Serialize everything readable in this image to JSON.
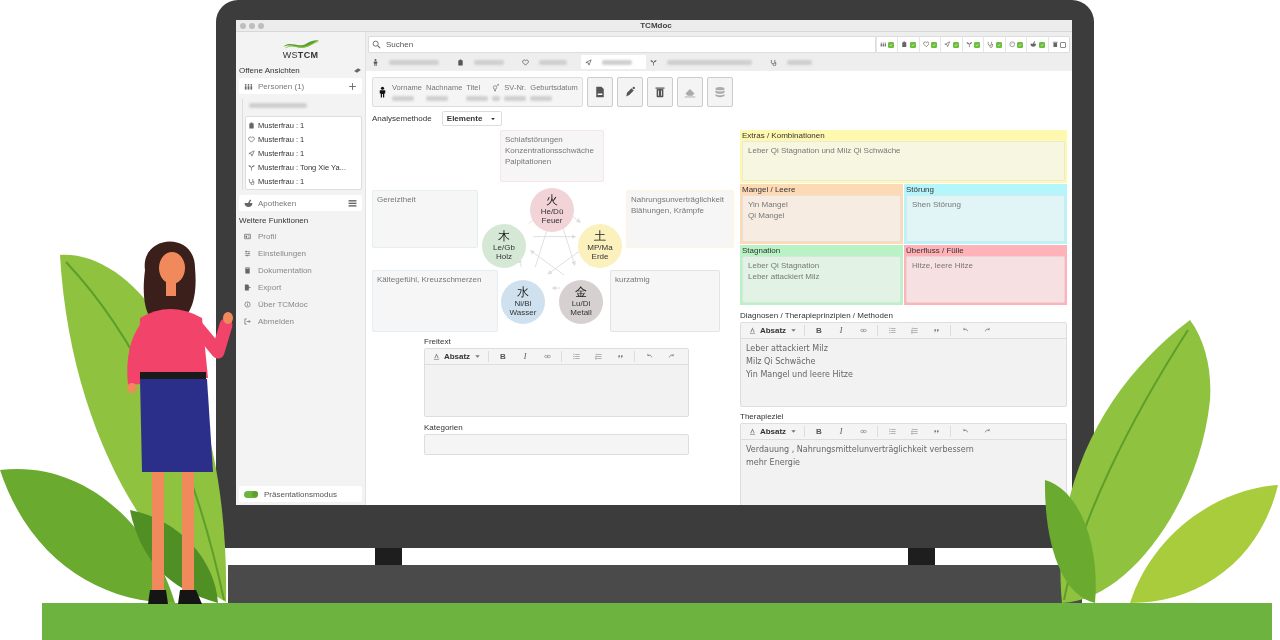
{
  "window": {
    "title": "TCMdoc"
  },
  "logo": {
    "text": "WS**TCM**"
  },
  "sidebar": {
    "open_views_label": "Offene Ansichten",
    "persons": {
      "label": "Personen (1)"
    },
    "views": [
      {
        "label": "Musterfrau : 1"
      },
      {
        "label": "Musterfrau : 1"
      },
      {
        "label": "Musterfrau : 1"
      },
      {
        "label": "Musterfrau : Tong Xie Ya..."
      },
      {
        "label": "Musterfrau : 1"
      }
    ],
    "pharmacies": {
      "label": "Apotheken"
    },
    "more_label": "Weitere Funktionen",
    "functions": [
      {
        "label": "Profil"
      },
      {
        "label": "Einstellungen"
      },
      {
        "label": "Dokumentation"
      },
      {
        "label": "Export"
      },
      {
        "label": "Über TCMdoc"
      },
      {
        "label": "Abmelden"
      }
    ],
    "presentation_mode": {
      "label": "Präsentationsmodus",
      "on": true
    }
  },
  "search": {
    "placeholder": "Suchen"
  },
  "filters": [
    {
      "checked": true
    },
    {
      "checked": true
    },
    {
      "checked": true
    },
    {
      "checked": true
    },
    {
      "checked": true
    },
    {
      "checked": true
    },
    {
      "checked": true
    },
    {
      "checked": true
    },
    {
      "checked": false
    }
  ],
  "tabs": [
    {
      "selected": false
    },
    {
      "selected": false
    },
    {
      "selected": false
    },
    {
      "selected": true
    },
    {
      "selected": false
    },
    {
      "selected": false
    }
  ],
  "patient": {
    "columns": [
      {
        "kind": "text",
        "label": "Vorname"
      },
      {
        "kind": "text",
        "label": "Nachname"
      },
      {
        "kind": "text",
        "label": "Titel"
      },
      {
        "kind": "gender"
      },
      {
        "kind": "text",
        "label": "SV-Nr."
      },
      {
        "kind": "text",
        "label": "Geburtsdatum"
      }
    ]
  },
  "analysis": {
    "label": "Analysemethode",
    "method": "Elemente"
  },
  "elements": [
    {
      "char": "火",
      "organ": "He/Dü",
      "name": "Feuer",
      "color": "#f1d3d8",
      "symptoms": [
        "Schlafstörungen",
        "Konzentrationsschwäche",
        "Palpitationen"
      ]
    },
    {
      "char": "木",
      "organ": "Le/Gb",
      "name": "Holz",
      "color": "#d5e8d5",
      "symptoms": [
        "Gereiztheit"
      ]
    },
    {
      "char": "土",
      "organ": "MP/Ma",
      "name": "Erde",
      "color": "#fbf1bd",
      "symptoms": [
        "Nahrungsunverträglichkeit",
        "Blähungen, Krämpfe"
      ]
    },
    {
      "char": "水",
      "organ": "Ni/Bl",
      "name": "Wasser",
      "color": "#cfe1ef",
      "symptoms": [
        "Kältegefühl, Kreuzschmerzen"
      ]
    },
    {
      "char": "金",
      "organ": "Lu/Di",
      "name": "Metall",
      "color": "#d6d0d0",
      "symptoms": [
        "kurzatmig"
      ]
    }
  ],
  "freitext": {
    "label": "Freitext",
    "toolbar": {
      "format": "Absatz",
      "bold": "B",
      "italic": "I"
    }
  },
  "categories": {
    "label": "Kategorien"
  },
  "patterns": [
    {
      "label": "Extras / Kombinationen",
      "color": "#fff9b0",
      "lines": [
        "Leber Qi Stagnation und Milz Qi Schwäche"
      ]
    },
    {
      "label": "Mangel / Leere",
      "color": "#fdd9b5",
      "lines": [
        "Yin Mangel",
        "Qi Mangel"
      ]
    },
    {
      "label": "Störung",
      "color": "#b5f6fc",
      "lines": [
        "Shen Störung"
      ]
    },
    {
      "label": "Stagnation",
      "color": "#b9f2c5",
      "lines": [
        "Leber Qi Stagnation",
        "Leber attackiert Milz"
      ]
    },
    {
      "label": "Überfluss / Fülle",
      "color": "#ffb2b8",
      "lines": [
        "Hitze, leere Hitze"
      ]
    }
  ],
  "diagnoses": {
    "label": "Diagnosen / Therapieprinzipien / Methoden",
    "toolbar": {
      "format": "Absatz",
      "bold": "B",
      "italic": "I"
    },
    "lines": [
      "Leber attackiert Milz",
      "Milz Qi Schwäche",
      "Yin Mangel und leere Hitze"
    ]
  },
  "therapy_goal": {
    "label": "Therapieziel",
    "toolbar": {
      "format": "Absatz",
      "bold": "B",
      "italic": "I"
    },
    "lines": [
      "Verdauung , Nahrungsmittelunverträglichkeit verbessern",
      "mehr Energie"
    ]
  }
}
